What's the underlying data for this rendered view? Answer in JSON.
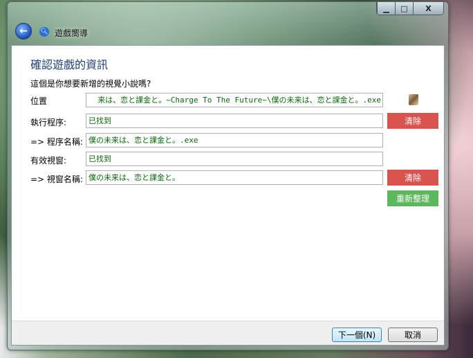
{
  "window": {
    "title": "遊戲嚮導",
    "controls": {
      "minimize": "▁",
      "maximize": "□",
      "close": "X"
    }
  },
  "page": {
    "heading": "確認遊戲的資訊",
    "question": "這個是你想要新增的視覺小說嗎?"
  },
  "fields": [
    {
      "label": "位置",
      "value": "来は、恋と課金と。~Charge To The Future~\\僕の未来は、恋と課金と。.exe"
    },
    {
      "label": "執行程序:",
      "value": "已找到"
    },
    {
      "label": "=> 程序名稱:",
      "value": "僕の未来は、恋と課金と。.exe"
    },
    {
      "label": "有效視窗:",
      "value": "已找到"
    },
    {
      "label": "=> 視窗名稱:",
      "value": "僕の未来は、恋と課金と。"
    }
  ],
  "buttons": {
    "clear_process": "清除",
    "clear_window": "清除",
    "refresh": "重新整理",
    "next": "下一個(N)",
    "cancel": "取消"
  },
  "colors": {
    "clear": "#d9534f",
    "refresh": "#5cb85c",
    "value_text": "#0a6a0a",
    "heading": "#1e3f7a"
  }
}
